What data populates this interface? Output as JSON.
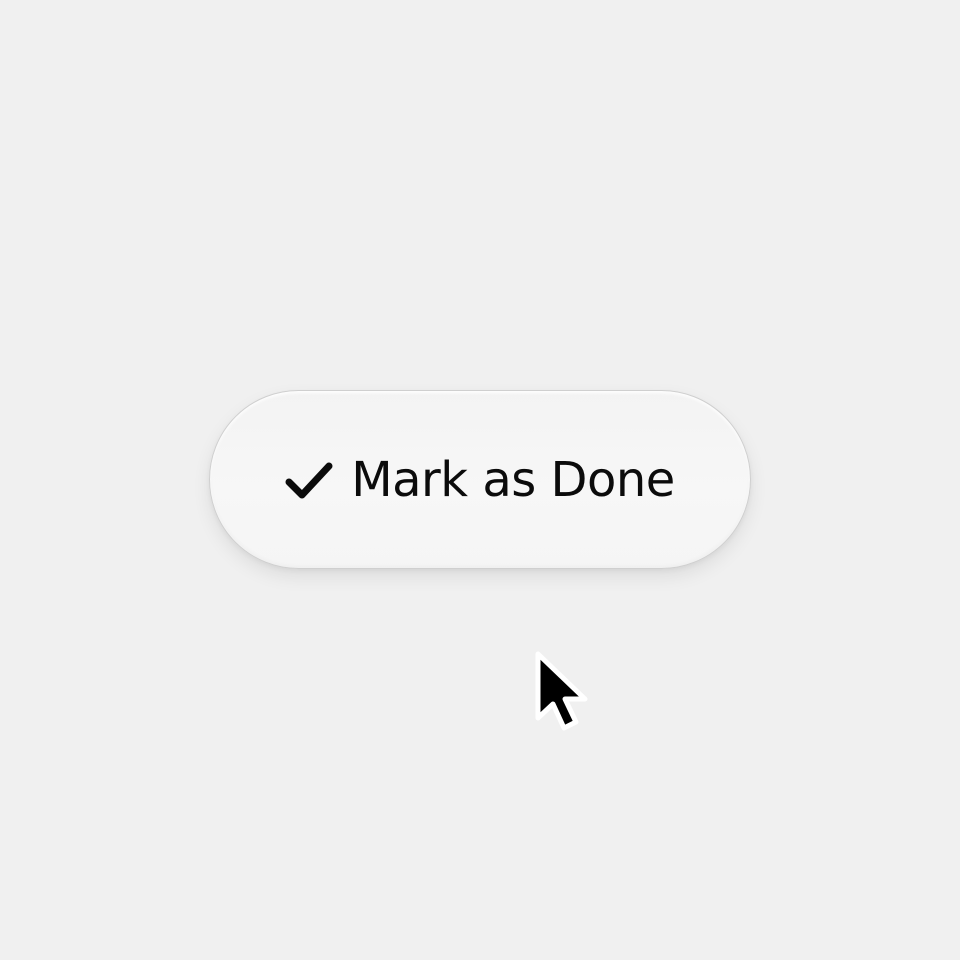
{
  "button": {
    "icon": "checkmark-icon",
    "label": "Mark as Done"
  },
  "cursor": {
    "icon": "mouse-pointer-icon"
  },
  "colors": {
    "background": "#f0f0f0",
    "button_fill": "#f5f5f5",
    "button_border": "#cfcfcf",
    "text": "#0b0b0b",
    "cursor_fill": "#000000",
    "cursor_outline": "#ffffff"
  }
}
